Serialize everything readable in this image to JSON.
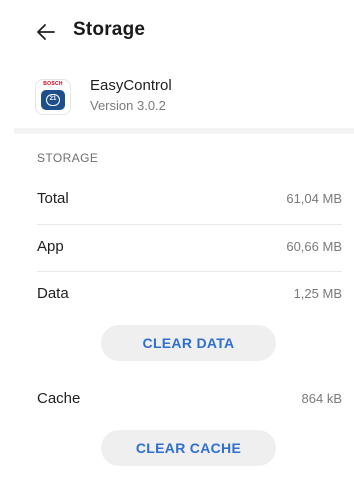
{
  "header": {
    "title": "Storage",
    "back_icon": "arrow-left-icon"
  },
  "app": {
    "name": "EasyControl",
    "version": "Version 3.0.2",
    "icon_brand_text": "BOSCH",
    "icon_badge_text": "21"
  },
  "storage": {
    "section_title": "STORAGE",
    "rows": [
      {
        "label": "Total",
        "value": "61,04 MB"
      },
      {
        "label": "App",
        "value": "60,66 MB"
      },
      {
        "label": "Data",
        "value": "1,25 MB"
      }
    ],
    "clear_data_label": "CLEAR DATA",
    "cache": {
      "label": "Cache",
      "value": "864 kB"
    },
    "clear_cache_label": "CLEAR CACHE"
  },
  "colors": {
    "accent": "#2f6fcf",
    "button_bg": "#efefef",
    "brand_red": "#d6001c",
    "brand_blue": "#1f4e8c"
  }
}
